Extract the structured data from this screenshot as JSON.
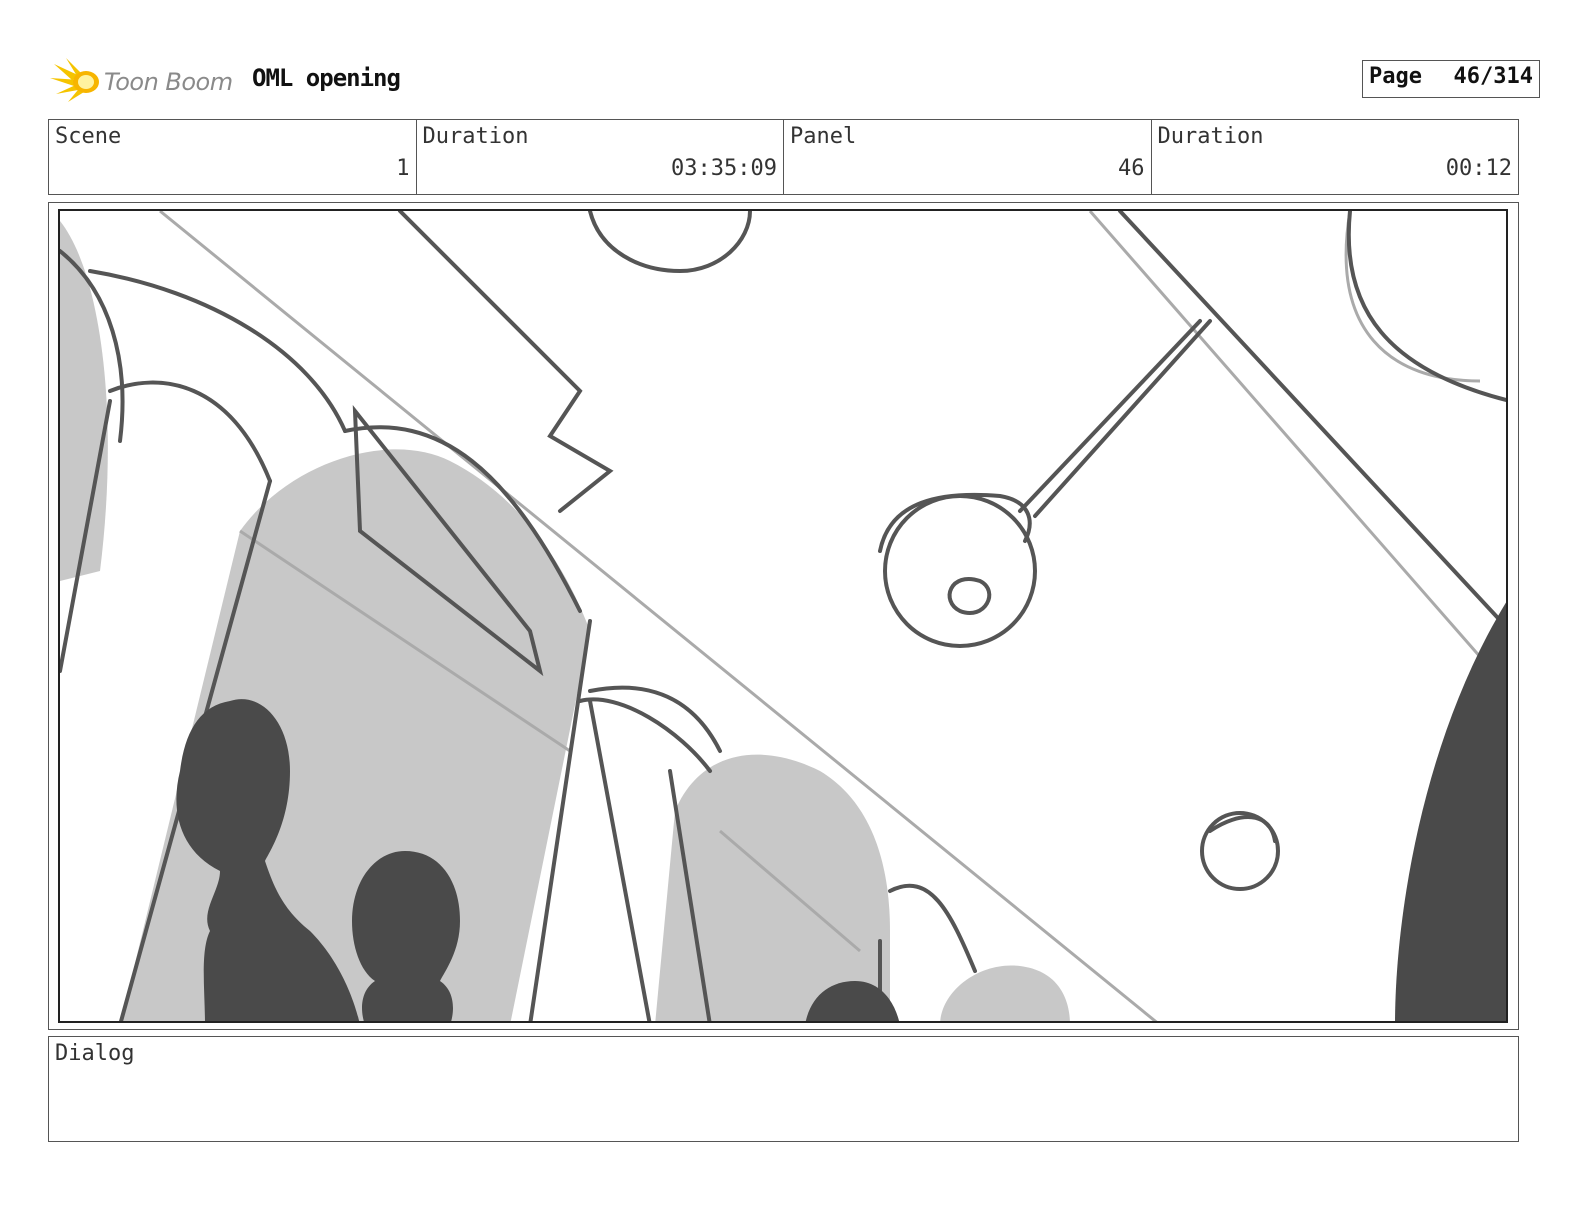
{
  "header": {
    "logo_text": "Toon Boom",
    "project_title": "OML opening",
    "page_label": "Page",
    "page_number": "46/314"
  },
  "info": {
    "scene_label": "Scene",
    "scene_value": "1",
    "scene_duration_label": "Duration",
    "scene_duration_value": "03:35:09",
    "panel_label": "Panel",
    "panel_value": "46",
    "panel_duration_label": "Duration",
    "panel_duration_value": "00:12"
  },
  "dialog": {
    "label": "Dialog"
  },
  "colors": {
    "logo_accent": "#f5c400",
    "sketch_line": "#555555",
    "sketch_fill": "#c8c8c8",
    "silhouette": "#4a4a4a"
  }
}
